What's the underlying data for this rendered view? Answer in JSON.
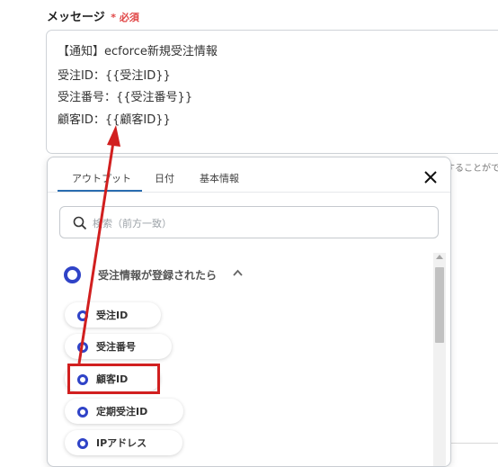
{
  "field": {
    "label": "メッセージ",
    "required_mark": "*",
    "required_text": "必須"
  },
  "message_lines": [
    "【通知】ecforce新規受注情報",
    "受注ID：{{受注ID}}",
    "受注番号：{{受注番号}}",
    "顧客ID：{{顧客ID}}"
  ],
  "side_hint": "することがで",
  "popup": {
    "tabs": [
      "アウトプット",
      "日付",
      "基本情報"
    ],
    "active_tab": "アウトプット",
    "close_icon": "close-icon",
    "search_placeholder": "検索（前方一致）",
    "group_title": "受注情報が登録されたら",
    "items": [
      "受注ID",
      "受注番号",
      "顧客ID",
      "定期受注ID",
      "IPアドレス"
    ],
    "highlighted_item": "顧客ID"
  },
  "colors": {
    "accent": "#2f43c7",
    "tab_underline": "#2a6db0",
    "annotation_red": "#d11f1f",
    "required_red": "#e04545"
  }
}
